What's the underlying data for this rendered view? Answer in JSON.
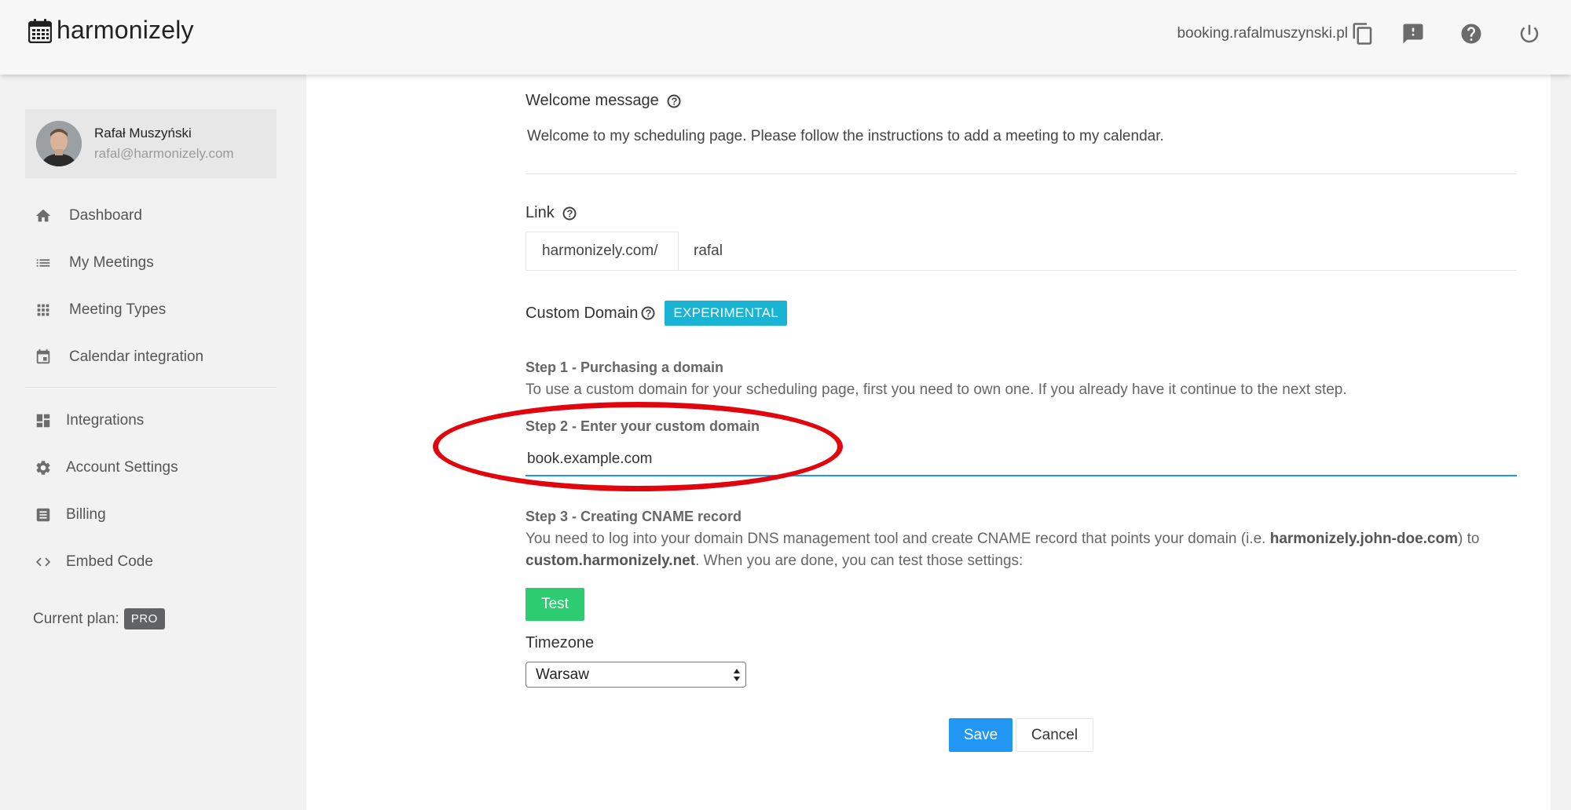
{
  "app": {
    "name": "harmonizely",
    "logo_icon": "calendar-icon"
  },
  "header": {
    "domain": "booking.rafalmuszynski.pl",
    "icons": [
      "copy-icon",
      "feedback-icon",
      "help-icon",
      "power-icon"
    ]
  },
  "user": {
    "name": "Rafał Muszyński",
    "email": "rafal@harmonizely.com"
  },
  "sidebar": {
    "items": [
      {
        "label": "Dashboard",
        "icon": "home-icon"
      },
      {
        "label": "My Meetings",
        "icon": "list-icon"
      },
      {
        "label": "Meeting Types",
        "icon": "grid-icon"
      },
      {
        "label": "Calendar integration",
        "icon": "calendar-icon"
      },
      {
        "label": "Integrations",
        "icon": "dashboard-icon"
      },
      {
        "label": "Account Settings",
        "icon": "gear-icon"
      },
      {
        "label": "Billing",
        "icon": "receipt-icon"
      },
      {
        "label": "Embed Code",
        "icon": "code-icon"
      }
    ],
    "plan_label": "Current plan:",
    "plan_value": "PRO"
  },
  "form": {
    "welcome": {
      "label": "Welcome message",
      "text": "Welcome to my scheduling page. Please follow the instructions to add a meeting to my calendar."
    },
    "link": {
      "label": "Link",
      "prefix": "harmonizely.com/",
      "value": "rafal"
    },
    "custom_domain": {
      "label": "Custom Domain",
      "badge": "EXPERIMENTAL",
      "step1_title": "Step 1 - Purchasing a domain",
      "step1_desc": "To use a custom domain for your scheduling page, first you need to own one. If you already have it continue to the next step.",
      "step2_title": "Step 2 - Enter your custom domain",
      "domain_value": "book.example.com",
      "step3_title": "Step 3 - Creating CNAME record",
      "step3_desc_a": "You need to log into your domain DNS management tool and create CNAME record that points your domain (i.e. ",
      "step3_example": "harmonizely.john-doe.com",
      "step3_desc_b": ") to ",
      "step3_target": "custom.harmonizely.net",
      "step3_desc_c": ". When you are done, you can test those settings:",
      "test_label": "Test"
    },
    "timezone": {
      "label": "Timezone",
      "value": "Warsaw"
    },
    "save_label": "Save",
    "cancel_label": "Cancel"
  },
  "colors": {
    "accent_blue": "#2196f3",
    "badge_cyan": "#19b4d3",
    "test_green": "#2ecc71",
    "highlight_red": "#e1060e"
  }
}
